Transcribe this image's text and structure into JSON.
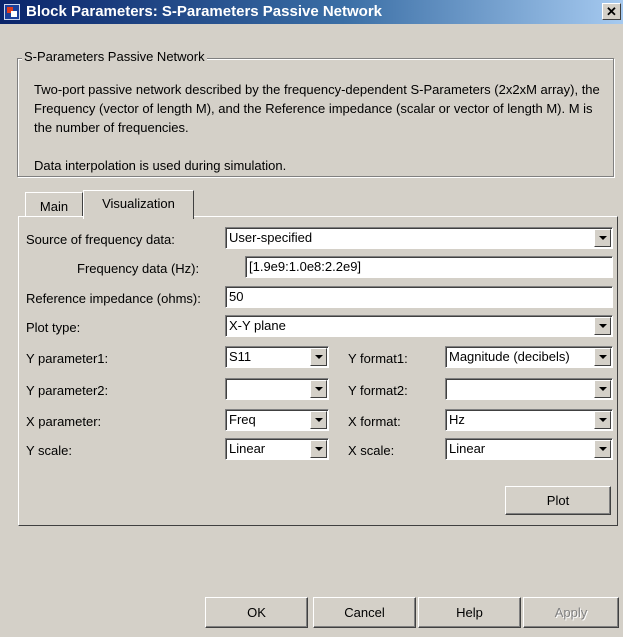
{
  "window": {
    "title": "Block Parameters: S-Parameters Passive Network",
    "close_symbol": "✕"
  },
  "group": {
    "legend": "S-Parameters Passive Network",
    "description": "Two-port passive network described by the frequency-dependent S-Parameters (2x2xM array),  the Frequency (vector of length M), and the Reference impedance (scalar or vector of length M).  M is the number of frequencies.",
    "note": "Data interpolation is used during simulation."
  },
  "tabs": [
    {
      "label": "Main",
      "active": false
    },
    {
      "label": "Visualization",
      "active": true
    }
  ],
  "visualization": {
    "source_label": "Source of frequency data:",
    "source_value": "User-specified",
    "freq_label": "Frequency data (Hz):",
    "freq_value": "[1.9e9:1.0e8:2.2e9]",
    "ref_label": "Reference impedance (ohms):",
    "ref_value": "50",
    "plot_type_label": "Plot type:",
    "plot_type_value": "X-Y plane",
    "yparam1_label": "Y parameter1:",
    "yparam1_value": "S11",
    "yformat1_label": "Y format1:",
    "yformat1_value": "Magnitude (decibels)",
    "yparam2_label": "Y parameter2:",
    "yparam2_value": "",
    "yformat2_label": "Y format2:",
    "yformat2_value": "",
    "xparam_label": "X parameter:",
    "xparam_value": "Freq",
    "xformat_label": "X format:",
    "xformat_value": "Hz",
    "yscale_label": "Y scale:",
    "yscale_value": "Linear",
    "xscale_label": "X scale:",
    "xscale_value": "Linear",
    "plot_button": "Plot"
  },
  "footer": {
    "ok": "OK",
    "cancel": "Cancel",
    "help": "Help",
    "apply": "Apply",
    "apply_enabled": false
  },
  "icons": {
    "window_icon": "simulink-block-icon",
    "dropdown_icon": "chevron-down-icon"
  },
  "colors": {
    "titlebar_start": "#0a246a",
    "titlebar_end": "#a6caf0",
    "dialog_bg": "#d4d0c8"
  }
}
